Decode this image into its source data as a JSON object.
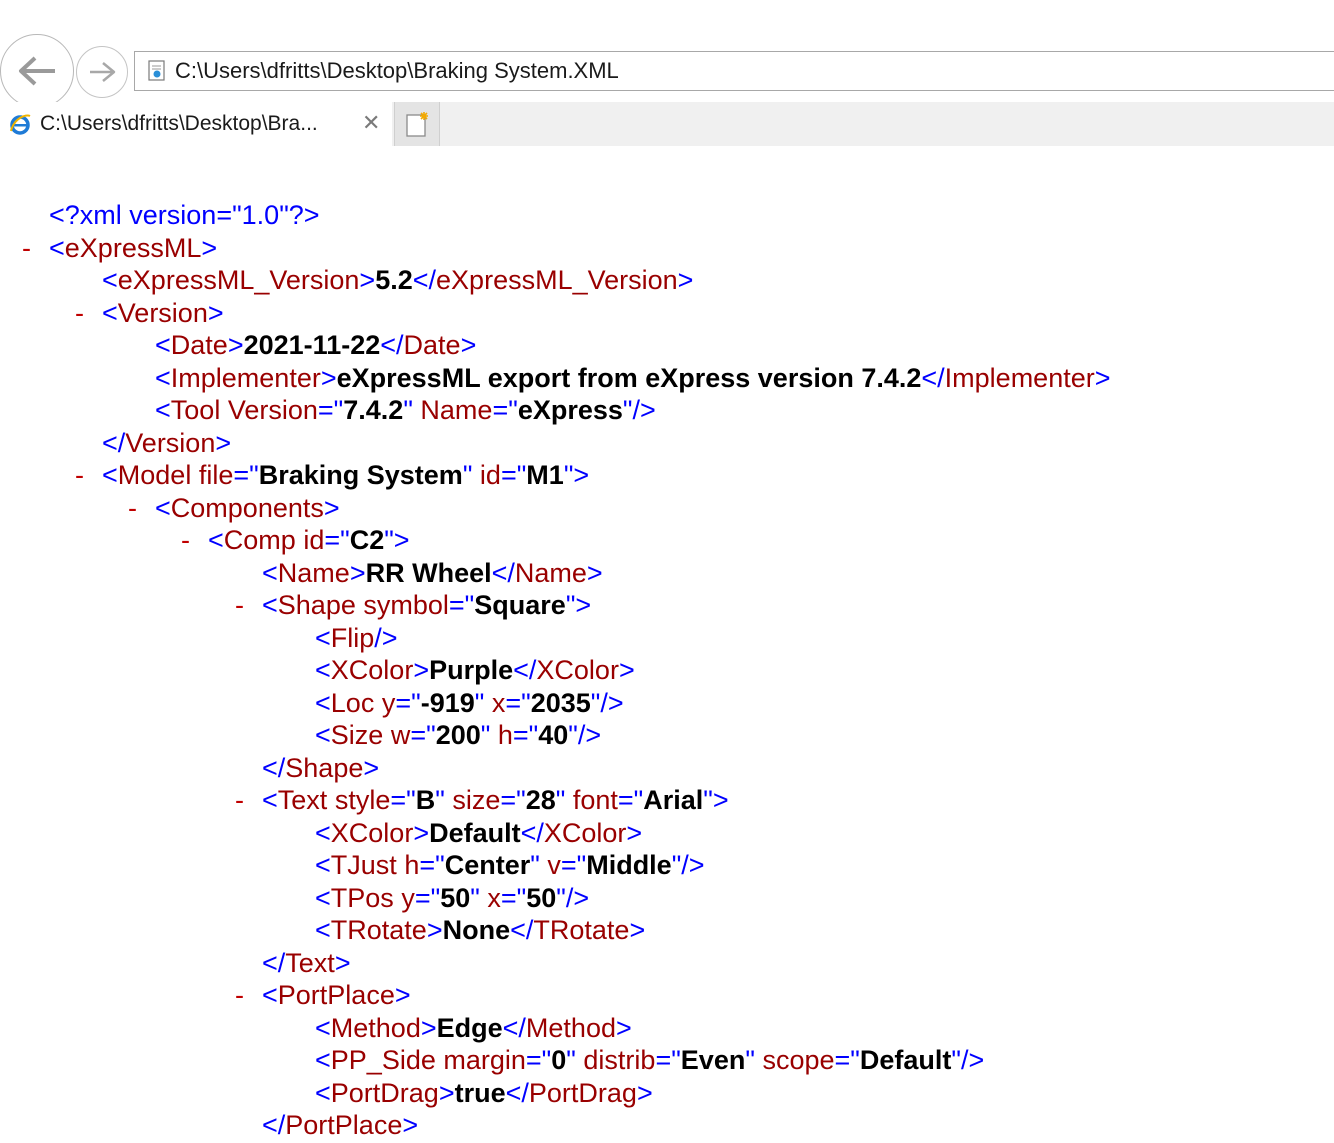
{
  "browser": {
    "address": "C:\\Users\\dfritts\\Desktop\\Braking System.XML",
    "tab_title": "C:\\Users\\dfritts\\Desktop\\Bra...",
    "tab_close_glyph": "✕"
  },
  "xml": {
    "declaration": "<?xml version=\"1.0\"?>",
    "root_tag": "eXpressML",
    "version_tag": "eXpressML_Version",
    "version_value": "5.2",
    "version_block_tag": "Version",
    "date_tag": "Date",
    "date_value": "2021-11-22",
    "implementer_tag": "Implementer",
    "implementer_value": "eXpressML export from eXpress version 7.4.2",
    "tool_tag": "Tool",
    "tool_attr_version": "Version",
    "tool_version_value": "7.4.2",
    "tool_attr_name": "Name",
    "tool_name_value": "eXpress",
    "model_tag": "Model",
    "model_attr_file": "file",
    "model_file_value": "Braking System",
    "model_attr_id": "id",
    "model_id_value": "M1",
    "components_tag": "Components",
    "comp_tag": "Comp",
    "comp_attr_id": "id",
    "comp_id_value": "C2",
    "name_tag": "Name",
    "name_value": "RR Wheel",
    "shape_tag": "Shape",
    "shape_attr_symbol": "symbol",
    "shape_symbol_value": "Square",
    "flip_tag": "Flip",
    "xcolor_tag": "XColor",
    "shape_xcolor_value": "Purple",
    "loc_tag": "Loc",
    "loc_attr_y": "y",
    "loc_y_value": "-919",
    "loc_attr_x": "x",
    "loc_x_value": "2035",
    "size_tag": "Size",
    "size_attr_w": "w",
    "size_w_value": "200",
    "size_attr_h": "h",
    "size_h_value": "40",
    "text_tag": "Text",
    "text_attr_style": "style",
    "text_style_value": "B",
    "text_attr_size": "size",
    "text_size_value": "28",
    "text_attr_font": "font",
    "text_font_value": "Arial",
    "text_xcolor_value": "Default",
    "tjust_tag": "TJust",
    "tjust_attr_h": "h",
    "tjust_h_value": "Center",
    "tjust_attr_v": "v",
    "tjust_v_value": "Middle",
    "tpos_tag": "TPos",
    "tpos_attr_y": "y",
    "tpos_y_value": "50",
    "tpos_attr_x": "x",
    "tpos_x_value": "50",
    "trotate_tag": "TRotate",
    "trotate_value": "None",
    "portplace_tag": "PortPlace",
    "method_tag": "Method",
    "method_value": "Edge",
    "ppside_tag": "PP_Side",
    "ppside_attr_margin": "margin",
    "ppside_margin_value": "0",
    "ppside_attr_distrib": "distrib",
    "ppside_distrib_value": "Even",
    "ppside_attr_scope": "scope",
    "ppside_scope_value": "Default",
    "portdrag_tag": "PortDrag",
    "portdrag_value": "true",
    "collapse_glyph": "-"
  },
  "colors": {
    "delimiter": "#0000ff",
    "name": "#990000",
    "collapse": "#c00000",
    "value": "#000000"
  }
}
